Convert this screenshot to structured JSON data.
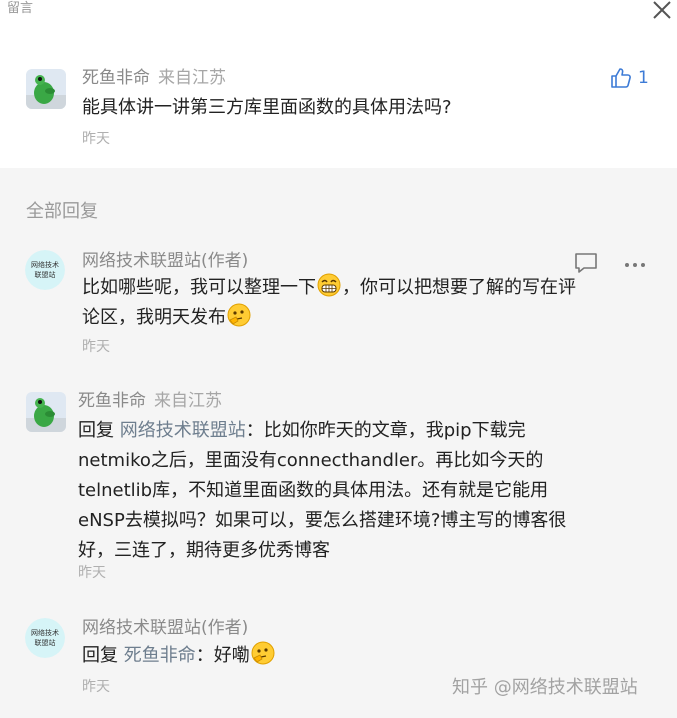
{
  "header": {
    "title": "留言"
  },
  "top_comment": {
    "author": "死鱼非命",
    "location": "来自江苏",
    "text": "能具体讲一讲第三方库里面函数的具体用法吗?",
    "time": "昨天",
    "likes": "1"
  },
  "replies_section": {
    "title": "全部回复"
  },
  "replies": [
    {
      "author": "网络技术联盟站(作者)",
      "text_a": "比如哪些呢，我可以整理一下",
      "text_b": "，你可以把想要了解的写在评",
      "text_c": "论区，我明天发布",
      "time": "昨天",
      "avatar_text": "网络技术联盟站"
    },
    {
      "author": "死鱼非命",
      "location": "来自江苏",
      "reply_prefix": "回复",
      "reply_target": "网络技术联盟站",
      "lines": [
        "：比如你昨天的文章，我pip下载完",
        "netmiko之后，里面没有connecthandler。再比如今天的",
        "telnetlib库，不知道里面函数的具体用法。还有就是它能用",
        "eNSP去模拟吗？如果可以，要怎么搭建环境?博主写的博客很",
        "好，三连了，期待更多优秀博客"
      ],
      "time": "昨天"
    },
    {
      "author": "网络技术联盟站(作者)",
      "reply_prefix": "回复",
      "reply_target": "死鱼非命",
      "text": "：好嘞",
      "time": "昨天",
      "avatar_text": "网络技术联盟站"
    }
  ],
  "watermark": "知乎 @网络技术联盟站",
  "colors": {
    "like_blue": "#3d7bd6",
    "muted": "#999999",
    "background": "#f5f5f5"
  }
}
